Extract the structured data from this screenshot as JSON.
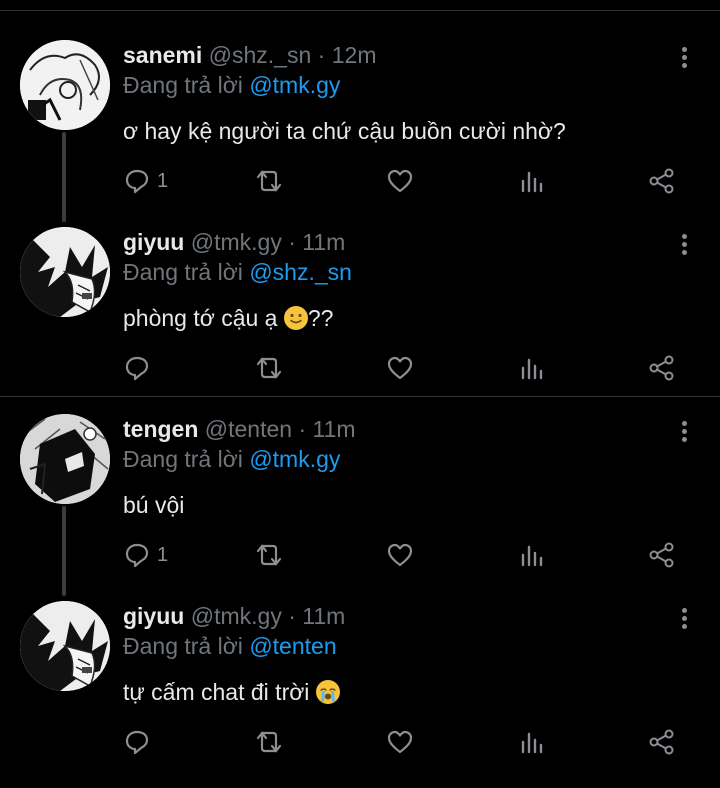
{
  "colors": {
    "background": "#000000",
    "mention": "#1d9bf0",
    "muted": "#71767b",
    "text": "#e7e9ea"
  },
  "tweets": [
    {
      "name": "sanemi",
      "handle": "@shz._sn",
      "dot": "·",
      "time": "12m",
      "reply_prefix": "Đang trả lời",
      "reply_to": "@tmk.gy",
      "text": "ơ hay kệ người ta chứ cậu buồn cười nhờ?",
      "emoji": "",
      "text_after": "",
      "reply_count": "1",
      "avatar_icon": "avatar-sketch-icon"
    },
    {
      "name": "giyuu",
      "handle": "@tmk.gy",
      "dot": "·",
      "time": "11m",
      "reply_prefix": "Đang trả lời",
      "reply_to": "@shz._sn",
      "text": "phòng tớ cậu ạ",
      "emoji": "slightly-smiling-face",
      "text_after": "??",
      "reply_count": "",
      "avatar_icon": "avatar-manga-icon"
    },
    {
      "name": "tengen",
      "handle": "@tenten",
      "dot": "·",
      "time": "11m",
      "reply_prefix": "Đang trả lời",
      "reply_to": "@tmk.gy",
      "text": "bú vội",
      "emoji": "",
      "text_after": "",
      "reply_count": "1",
      "avatar_icon": "avatar-dark-icon"
    },
    {
      "name": "giyuu",
      "handle": "@tmk.gy",
      "dot": "·",
      "time": "11m",
      "reply_prefix": "Đang trả lời",
      "reply_to": "@tenten",
      "text": "tự cấm chat đi trời",
      "emoji": "loudly-crying-face",
      "text_after": "",
      "reply_count": "",
      "avatar_icon": "avatar-manga-icon"
    }
  ]
}
